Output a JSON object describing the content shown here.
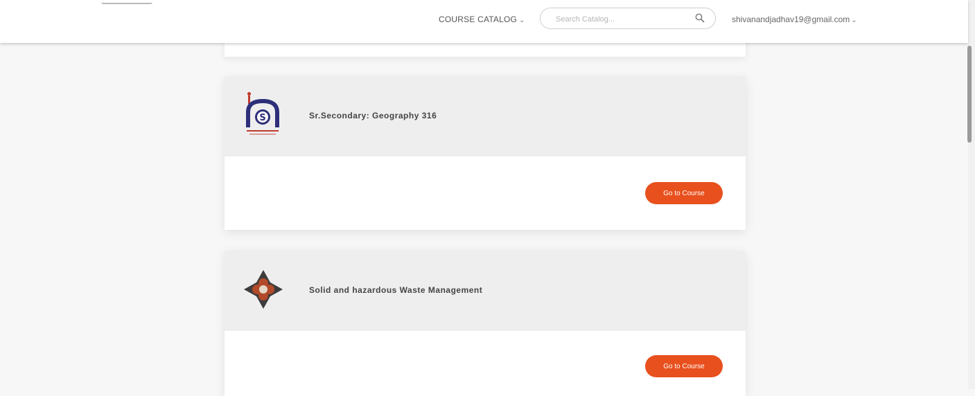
{
  "header": {
    "catalog_label": "COURSE CATALOG",
    "catalog_caret": "⌄",
    "search_placeholder": "Search Catalog...",
    "user_email": "shivanandjadhav19@gmail.com",
    "user_caret": "⌄"
  },
  "courses": [
    {
      "title": "Sr.Secondary: Geography 316",
      "logo_icon": "nios-logo-icon",
      "button_label": "Go to Course"
    },
    {
      "title": "Solid and hazardous Waste Management",
      "logo_icon": "waste-management-logo-icon",
      "button_label": "Go to Course"
    }
  ],
  "colors": {
    "accent": "#e8501d",
    "card_header": "#eeeeee",
    "page_bg": "#f7f7f7"
  }
}
